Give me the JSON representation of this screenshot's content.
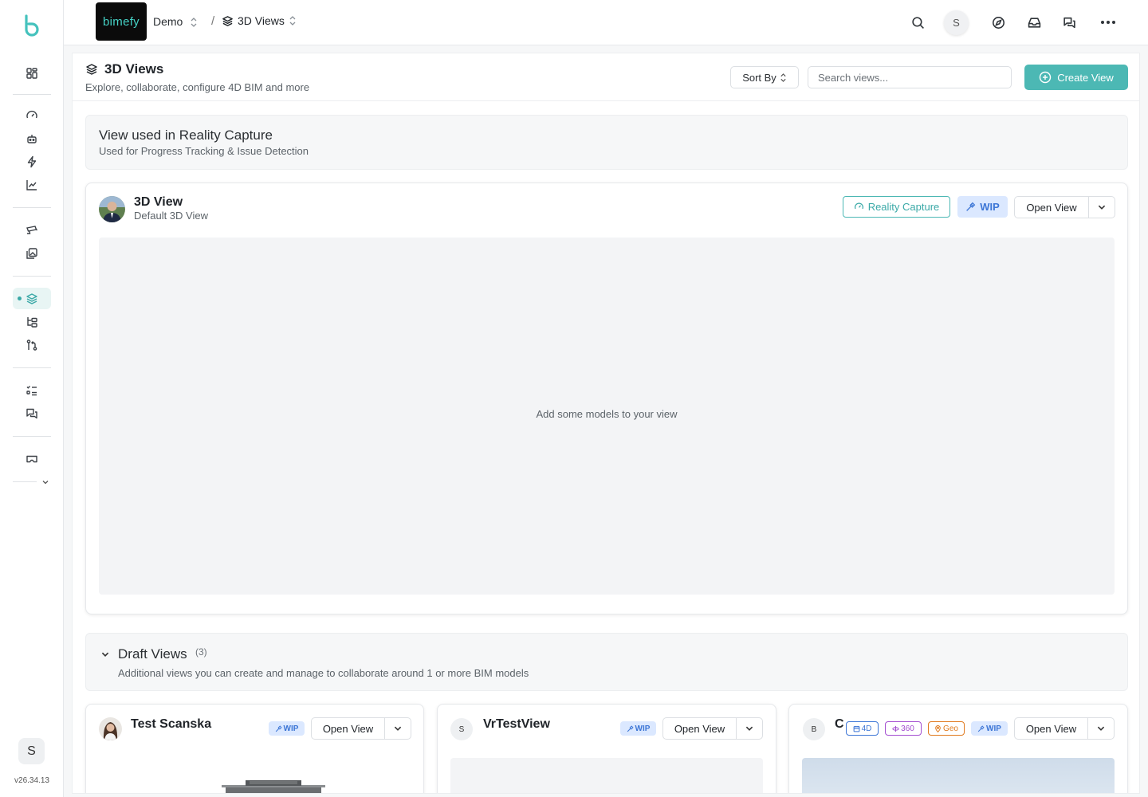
{
  "app": {
    "brand": "bimefy",
    "version": "v26.34.13",
    "user_initial": "S",
    "accent": "#4cb8b4"
  },
  "breadcrumb": {
    "org": "Demo",
    "separator": "/",
    "page": "3D Views"
  },
  "header": {
    "title": "3D Views",
    "subtitle": "Explore, collaborate, configure 4D BIM and more",
    "sort_label": "Sort By",
    "search_placeholder": "Search views...",
    "create_label": "Create View"
  },
  "reality_section": {
    "title": "View used in Reality Capture",
    "subtitle": "Used for Progress Tracking & Issue Detection"
  },
  "main_view": {
    "title": "3D View",
    "subtitle": "Default 3D View",
    "tag_rc": "Reality Capture",
    "tag_wip": "WIP",
    "open_label": "Open View",
    "empty_message": "Add some models to your view"
  },
  "drafts": {
    "title": "Draft Views",
    "count": "(3)",
    "subtitle": "Additional views you can create and manage to collaborate around 1 or more BIM models",
    "cards": [
      {
        "title": "Test Scanska",
        "wip": "WIP",
        "open_label": "Open View"
      },
      {
        "title": "VrTestView",
        "initial": "S",
        "wip": "WIP",
        "open_label": "Open View"
      },
      {
        "title": "C",
        "initial": "B",
        "tag_4d": "4D",
        "tag_360": "360",
        "tag_geo": "Geo",
        "wip": "WIP",
        "open_label": "Open View"
      }
    ]
  }
}
